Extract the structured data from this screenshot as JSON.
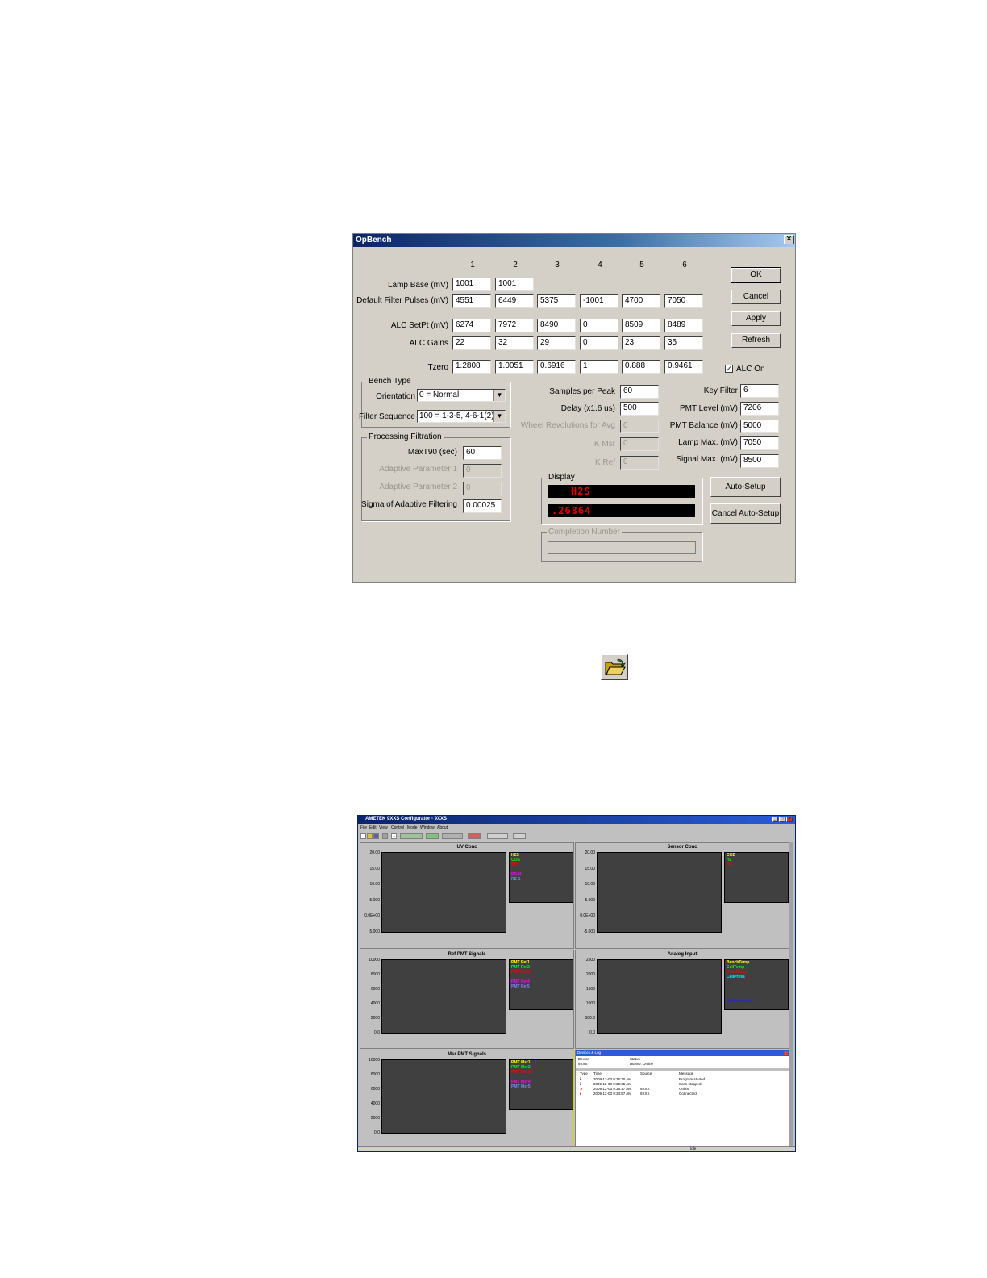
{
  "dialog": {
    "title": "OpBench",
    "close": "✕",
    "columns": [
      "1",
      "2",
      "3",
      "4",
      "5",
      "6"
    ],
    "rows": [
      {
        "label": "Lamp Base (mV)",
        "values": [
          "1001",
          "1001"
        ]
      },
      {
        "label": "Default Filter Pulses (mV)",
        "values": [
          "4551",
          "6449",
          "5375",
          "-1001",
          "4700",
          "7050"
        ]
      },
      {
        "label": "ALC SetPt (mV)",
        "values": [
          "6274",
          "7972",
          "8490",
          "0",
          "8509",
          "8489"
        ]
      },
      {
        "label": "ALC Gains",
        "values": [
          "22",
          "32",
          "29",
          "0",
          "23",
          "35"
        ]
      },
      {
        "label": "Tzero",
        "values": [
          "1.2808",
          "1.0051",
          "0.6916",
          "1",
          "0.888",
          "0.9461"
        ]
      }
    ],
    "buttons": {
      "ok": "OK",
      "cancel": "Cancel",
      "apply": "Apply",
      "refresh": "Refresh",
      "auto_setup": "Auto-Setup",
      "cancel_auto_setup": "Cancel Auto-Setup"
    },
    "alc_on": {
      "label": "ALC On",
      "checked": "✓"
    },
    "bench_type": {
      "title": "Bench Type",
      "orientation_label": "Orientation",
      "orientation_value": "0 = Normal",
      "filter_sequence_label": "Filter Sequence",
      "filter_sequence_value": "100 = 1-3-5, 4-6-1(2)"
    },
    "processing": {
      "title": "Processing Filtration",
      "fields": [
        {
          "label": "MaxT90 (sec)",
          "value": "60",
          "enabled": true
        },
        {
          "label": "Adaptive Parameter 1",
          "value": "0",
          "enabled": false
        },
        {
          "label": "Adaptive Parameter 2",
          "value": "0",
          "enabled": false
        },
        {
          "label": "Sigma of Adaptive Filtering",
          "value": "0.00025",
          "enabled": true
        }
      ]
    },
    "middle_fields": [
      {
        "label": "Samples per Peak",
        "value": "60",
        "enabled": true
      },
      {
        "label": "Delay (x1.6 us)",
        "value": "500",
        "enabled": true
      },
      {
        "label": "Wheel Revolutions for Avg",
        "value": "0",
        "enabled": false
      },
      {
        "label": "K Msr",
        "value": "0",
        "enabled": false
      },
      {
        "label": "K Ref",
        "value": "0",
        "enabled": false
      }
    ],
    "right_fields": [
      {
        "label": "Key Filter",
        "value": "6"
      },
      {
        "label": "PMT Level (mV)",
        "value": "7206"
      },
      {
        "label": "PMT Balance (mV)",
        "value": "5000"
      },
      {
        "label": "Lamp Max. (mV)",
        "value": "7050"
      },
      {
        "label": "Signal Max. (mV)",
        "value": "8500"
      }
    ],
    "display": {
      "title": "Display",
      "line1": "H2S",
      "line2": ".26864"
    },
    "completion": {
      "title": "Completion Number"
    }
  },
  "app": {
    "title": "AMETEK 9XXS Configurator - 9XXS",
    "menu": [
      "File",
      "Edit",
      "View",
      "Control",
      "Mode",
      "Window",
      "About"
    ],
    "toolbar_icon": "1",
    "panes": [
      {
        "title": "UV Conc",
        "ticks": [
          "20.00",
          "15.00",
          "10.00",
          "5.000",
          "0.0E+00",
          "-5.000"
        ],
        "legend": [
          {
            "name": "H2S",
            "color": "#ffff00"
          },
          {
            "name": "COS",
            "color": "#00ff00"
          },
          {
            "name": "SO2",
            "color": "#ff0000"
          },
          {
            "name": "",
            "color": "#404040"
          },
          {
            "name": "RS-H",
            "color": "#ff00ff"
          },
          {
            "name": "RS-1",
            "color": "#8080ff"
          }
        ]
      },
      {
        "title": "Sensor Conc",
        "ticks": [
          "20.00",
          "15.00",
          "10.00",
          "5.000",
          "0.0E+00",
          "-5.000"
        ],
        "legend": [
          {
            "name": "CO2",
            "color": "#ffff00"
          },
          {
            "name": "H2",
            "color": "#00ff00"
          },
          {
            "name": "O2",
            "color": "#ff0000"
          }
        ]
      },
      {
        "title": "Ref PMT Signals",
        "ticks": [
          "10000",
          "8000",
          "6000",
          "4000",
          "2000",
          "0.0"
        ],
        "legend": [
          {
            "name": "PMT Ref1",
            "color": "#ffff00"
          },
          {
            "name": "PMT Ref2",
            "color": "#00ff00"
          },
          {
            "name": "PMT Ref3",
            "color": "#ff0000"
          },
          {
            "name": "",
            "color": "#404040"
          },
          {
            "name": "PMT Ref4",
            "color": "#ff00ff"
          },
          {
            "name": "PMT Ref5",
            "color": "#8080ff"
          }
        ]
      },
      {
        "title": "Analog Input",
        "ticks": [
          "2500",
          "2000",
          "1500",
          "1000",
          "500.0",
          "0.0"
        ],
        "legend": [
          {
            "name": "BenchTemp",
            "color": "#ffff00"
          },
          {
            "name": "CellTemp",
            "color": "#00ff00"
          },
          {
            "name": "OvenTemp",
            "color": "#ff0000"
          },
          {
            "name": "CellPress",
            "color": "#00ffff"
          },
          {
            "name": "",
            "color": "#404040"
          },
          {
            "name": "",
            "color": "#404040"
          },
          {
            "name": "",
            "color": "#404040"
          },
          {
            "name": "",
            "color": "#404040"
          },
          {
            "name": "AO Readback",
            "color": "#2020ff"
          }
        ]
      },
      {
        "title": "Msr PMT Signals",
        "ticks": [
          "10000",
          "8000",
          "6000",
          "4000",
          "2000",
          "0.0"
        ],
        "legend": [
          {
            "name": "PMT Msr1",
            "color": "#ffff00"
          },
          {
            "name": "PMT Msr2",
            "color": "#00ff00"
          },
          {
            "name": "PMT Msr3",
            "color": "#ff0000"
          },
          {
            "name": "",
            "color": "#404040"
          },
          {
            "name": "PMT Msr4",
            "color": "#ff00ff"
          },
          {
            "name": "PMT Msr5",
            "color": "#8080ff"
          }
        ]
      }
    ],
    "eventlog": {
      "title": "Devices & Log",
      "dev_headers": [
        "Device",
        "Status"
      ],
      "dev_row": [
        "9XXS",
        "DEMO: Online"
      ],
      "log_headers": [
        "Type",
        "Time",
        "Source",
        "Message"
      ],
      "log_rows": [
        {
          "type": "i",
          "color": "#0000ff",
          "time": "2009-12-03 9:35:30 AM",
          "source": "",
          "message": "Program started"
        },
        {
          "type": "i",
          "color": "#0000ff",
          "time": "2009-12-03 9:35:35 AM",
          "source": "",
          "message": "Scan stopped"
        },
        {
          "type": "✕",
          "color": "#ff0000",
          "time": "2009-12-03 9:35:17 AM",
          "source": "9XXS",
          "message": "Online"
        },
        {
          "type": "i",
          "color": "#0000ff",
          "time": "2009-12-03 9:34:57 AM",
          "source": "9XXS",
          "message": "Connected"
        }
      ]
    },
    "status": "Idle"
  }
}
